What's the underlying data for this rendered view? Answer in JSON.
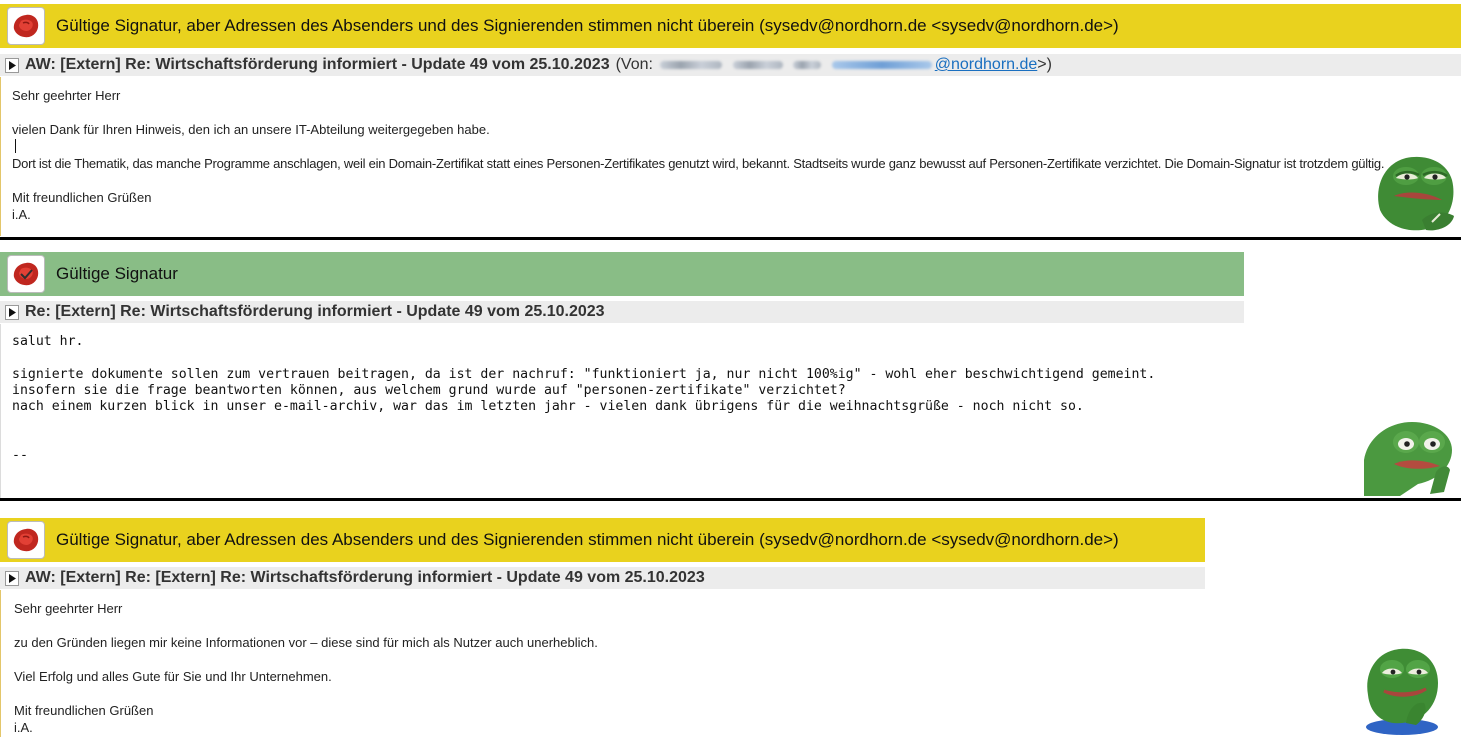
{
  "panel1": {
    "signature_status": "Gültige Signatur, aber Adressen des Absenders und des Signierenden stimmen nicht überein (sysedv@nordhorn.de <sysedv@nordhorn.de>)",
    "subject": "AW: [Extern] Re: Wirtschaftsförderung informiert - Update 49 vom 25.10.2023",
    "from_prefix": "(Von:",
    "from_domain": "@nordhorn.de",
    "from_suffix": ">)",
    "lines": [
      "Sehr geehrter Herr",
      "vielen Dank für Ihren Hinweis, den ich an unsere IT-Abteilung weitergegeben habe.",
      "Dort ist die Thematik, das manche Programme anschlagen, weil ein Domain-Zertifikat statt eines Personen-Zertifikates genutzt wird, bekannt. Stadtseits wurde ganz bewusst auf Personen-Zertifikate verzichtet. Die Domain-Signatur ist trotzdem gültig.",
      "Mit freundlichen Grüßen",
      "i.A."
    ]
  },
  "panel2": {
    "signature_status": "Gültige Signatur",
    "subject": "Re: [Extern] Re: Wirtschaftsförderung informiert - Update 49 vom 25.10.2023",
    "lines": [
      "salut hr.",
      "signierte dokumente sollen zum vertrauen beitragen, da ist der nachruf: \"funktioniert ja, nur nicht 100%ig\" - wohl eher beschwichtigend gemeint.",
      "insofern sie die frage beantworten können, aus welchem grund wurde auf \"personen-zertifikate\" verzichtet?",
      "nach einem kurzen blick in unser e-mail-archiv, war das im letzten jahr - vielen dank übrigens für die weihnachtsgrüße - noch nicht so.",
      "--"
    ]
  },
  "panel3": {
    "signature_status": "Gültige Signatur, aber Adressen des Absenders und des Signierenden stimmen nicht überein (sysedv@nordhorn.de <sysedv@nordhorn.de>)",
    "subject": "AW: [Extern] Re: [Extern] Re: Wirtschaftsförderung informiert - Update 49 vom 25.10.2023",
    "lines": [
      "Sehr geehrter Herr",
      "zu den Gründen liegen mir keine Informationen vor – diese sind für mich als Nutzer auch unerheblich.",
      "Viel Erfolg und alles Gute für Sie und Ihr Unternehmen.",
      "Mit freundlichen Grüßen",
      "i.A."
    ]
  },
  "colors": {
    "warning_bar": "#e9d21e",
    "valid_bar": "#89bd86",
    "subject_bar": "#ececec",
    "link": "#1a6fc0"
  },
  "icons": [
    "wax-seal-icon",
    "expand-triangle-icon",
    "frog-meme-image"
  ]
}
